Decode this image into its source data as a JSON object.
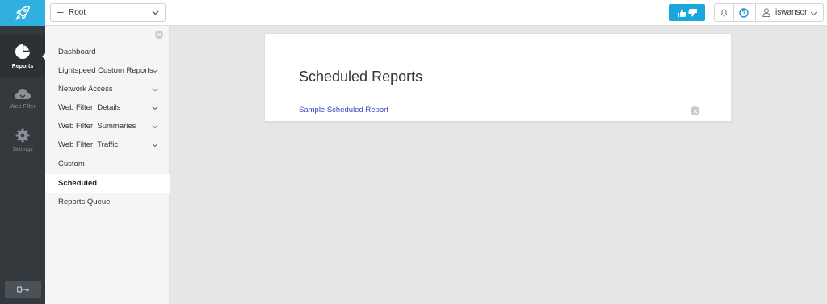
{
  "topbar": {
    "root_select": "Root",
    "username": "iswanson"
  },
  "rail": {
    "items": [
      {
        "label": "Reports",
        "icon": "pie-chart-icon",
        "active": true
      },
      {
        "label": "Web Filter",
        "icon": "cloud-icon",
        "active": false
      },
      {
        "label": "Settings",
        "icon": "gear-icon",
        "active": false
      }
    ]
  },
  "subnav": {
    "items": [
      {
        "label": "Dashboard",
        "expandable": false
      },
      {
        "label": "Lightspeed Custom Reports",
        "expandable": true
      },
      {
        "label": "Network Access",
        "expandable": true
      },
      {
        "label": "Web Filter: Details",
        "expandable": true
      },
      {
        "label": "Web Filter: Summaries",
        "expandable": true
      },
      {
        "label": "Web Filter: Traffic",
        "expandable": true
      },
      {
        "label": "Custom",
        "expandable": false
      },
      {
        "label": "Scheduled",
        "expandable": false,
        "active": true
      },
      {
        "label": "Reports Queue",
        "expandable": false
      }
    ]
  },
  "main": {
    "title": "Scheduled Reports",
    "reports": [
      {
        "name": "Sample Scheduled Report"
      }
    ]
  },
  "colors": {
    "accent": "#2fb0df",
    "rail_bg": "#33393d",
    "link": "#3a40c4"
  }
}
